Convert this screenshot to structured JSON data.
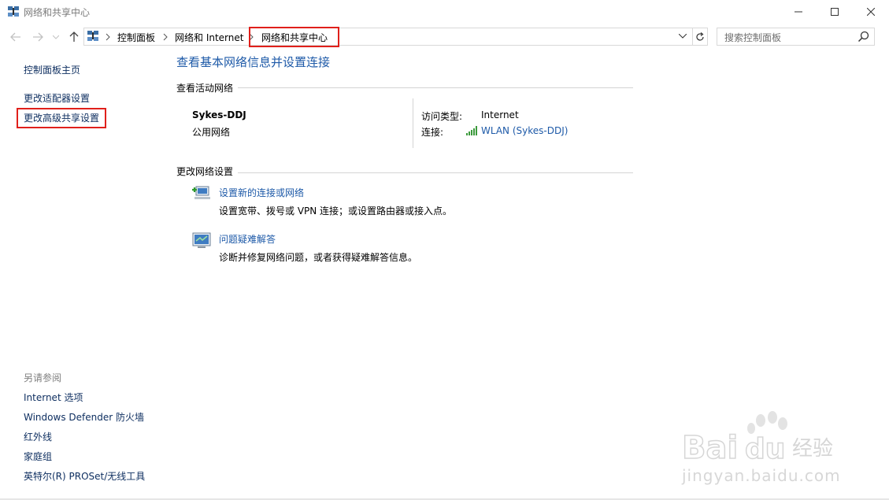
{
  "window": {
    "title": "网络和共享中心"
  },
  "address": {
    "crumbs": [
      "控制面板",
      "网络和 Internet",
      "网络和共享中心"
    ]
  },
  "search": {
    "placeholder": "搜索控制面板"
  },
  "sidebar": {
    "home": "控制面板主页",
    "links": [
      "更改适配器设置",
      "更改高级共享设置"
    ],
    "see_also_title": "另请参阅",
    "see_also": [
      "Internet 选项",
      "Windows Defender 防火墙",
      "红外线",
      "家庭组",
      "英特尔(R) PROSet/无线工具"
    ]
  },
  "main": {
    "heading": "查看基本网络信息并设置连接",
    "active_label": "查看活动网络",
    "network": {
      "name": "Sykes-DDJ",
      "type": "公用网络",
      "access_label": "访问类型:",
      "access_value": "Internet",
      "conn_label": "连接:",
      "conn_value": "WLAN (Sykes-DDJ)"
    },
    "change_label": "更改网络设置",
    "tasks": [
      {
        "link": "设置新的连接或网络",
        "desc": "设置宽带、拨号或 VPN 连接；或设置路由器或接入点。",
        "icon": "new-connection-icon"
      },
      {
        "link": "问题疑难解答",
        "desc": "诊断并修复网络问题，或者获得疑难解答信息。",
        "icon": "troubleshoot-icon"
      }
    ]
  },
  "watermark": {
    "text": "jingyan.baidu.com",
    "logo": "Baidu经验"
  },
  "colors": {
    "link": "#1e5aa8",
    "highlight": "#e0201b"
  }
}
